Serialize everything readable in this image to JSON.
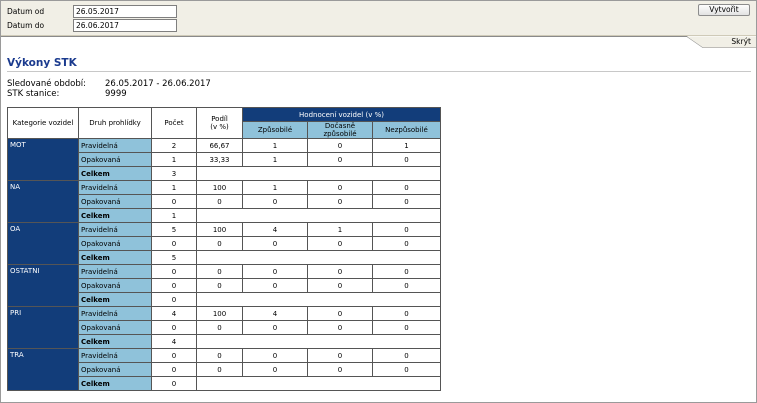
{
  "filters": {
    "date_from_label": "Datum od",
    "date_from_value": "26.05.2017",
    "date_to_label": "Datum do",
    "date_to_value": "26.06.2017",
    "create_label": "Vytvořit",
    "hide_label": "Skrýt"
  },
  "report": {
    "title": "Výkony STK",
    "period_label": "Sledované období:",
    "period_value": "26.05.2017 - 26.06.2017",
    "station_label": "STK stanice:",
    "station_value": "9999"
  },
  "table": {
    "headers": {
      "category": "Kategorie vozidel",
      "kind": "Druh prohlídky",
      "count": "Počet",
      "share_line1": "Podíl",
      "share_line2": "(v %)",
      "rating": "Hodnocení vozidel (v %)",
      "fit": "Způsobilé",
      "temp": "Dočasně způsobilé",
      "unfit": "Nezpůsobilé"
    },
    "groups": [
      {
        "category": "MOT",
        "rows": [
          {
            "kind": "Pravidelná",
            "count": "2",
            "share": "66,67",
            "fit": "1",
            "temp": "0",
            "unfit": "1"
          },
          {
            "kind": "Opakovaná",
            "count": "1",
            "share": "33,33",
            "fit": "1",
            "temp": "0",
            "unfit": "0"
          },
          {
            "kind": "Celkem",
            "count": "3",
            "share": "",
            "fit": "",
            "temp": "",
            "unfit": ""
          }
        ]
      },
      {
        "category": "NA",
        "rows": [
          {
            "kind": "Pravidelná",
            "count": "1",
            "share": "100",
            "fit": "1",
            "temp": "0",
            "unfit": "0"
          },
          {
            "kind": "Opakovaná",
            "count": "0",
            "share": "0",
            "fit": "0",
            "temp": "0",
            "unfit": "0"
          },
          {
            "kind": "Celkem",
            "count": "1",
            "share": "",
            "fit": "",
            "temp": "",
            "unfit": ""
          }
        ]
      },
      {
        "category": "OA",
        "rows": [
          {
            "kind": "Pravidelná",
            "count": "5",
            "share": "100",
            "fit": "4",
            "temp": "1",
            "unfit": "0"
          },
          {
            "kind": "Opakovaná",
            "count": "0",
            "share": "0",
            "fit": "0",
            "temp": "0",
            "unfit": "0"
          },
          {
            "kind": "Celkem",
            "count": "5",
            "share": "",
            "fit": "",
            "temp": "",
            "unfit": ""
          }
        ]
      },
      {
        "category": "OSTATNI",
        "rows": [
          {
            "kind": "Pravidelná",
            "count": "0",
            "share": "0",
            "fit": "0",
            "temp": "0",
            "unfit": "0"
          },
          {
            "kind": "Opakovaná",
            "count": "0",
            "share": "0",
            "fit": "0",
            "temp": "0",
            "unfit": "0"
          },
          {
            "kind": "Celkem",
            "count": "0",
            "share": "",
            "fit": "",
            "temp": "",
            "unfit": ""
          }
        ]
      },
      {
        "category": "PRI",
        "rows": [
          {
            "kind": "Pravidelná",
            "count": "4",
            "share": "100",
            "fit": "4",
            "temp": "0",
            "unfit": "0"
          },
          {
            "kind": "Opakovaná",
            "count": "0",
            "share": "0",
            "fit": "0",
            "temp": "0",
            "unfit": "0"
          },
          {
            "kind": "Celkem",
            "count": "4",
            "share": "",
            "fit": "",
            "temp": "",
            "unfit": ""
          }
        ]
      },
      {
        "category": "TRA",
        "rows": [
          {
            "kind": "Pravidelná",
            "count": "0",
            "share": "0",
            "fit": "0",
            "temp": "0",
            "unfit": "0"
          },
          {
            "kind": "Opakovaná",
            "count": "0",
            "share": "0",
            "fit": "0",
            "temp": "0",
            "unfit": "0"
          },
          {
            "kind": "Celkem",
            "count": "0",
            "share": "",
            "fit": "",
            "temp": "",
            "unfit": ""
          }
        ]
      }
    ]
  }
}
